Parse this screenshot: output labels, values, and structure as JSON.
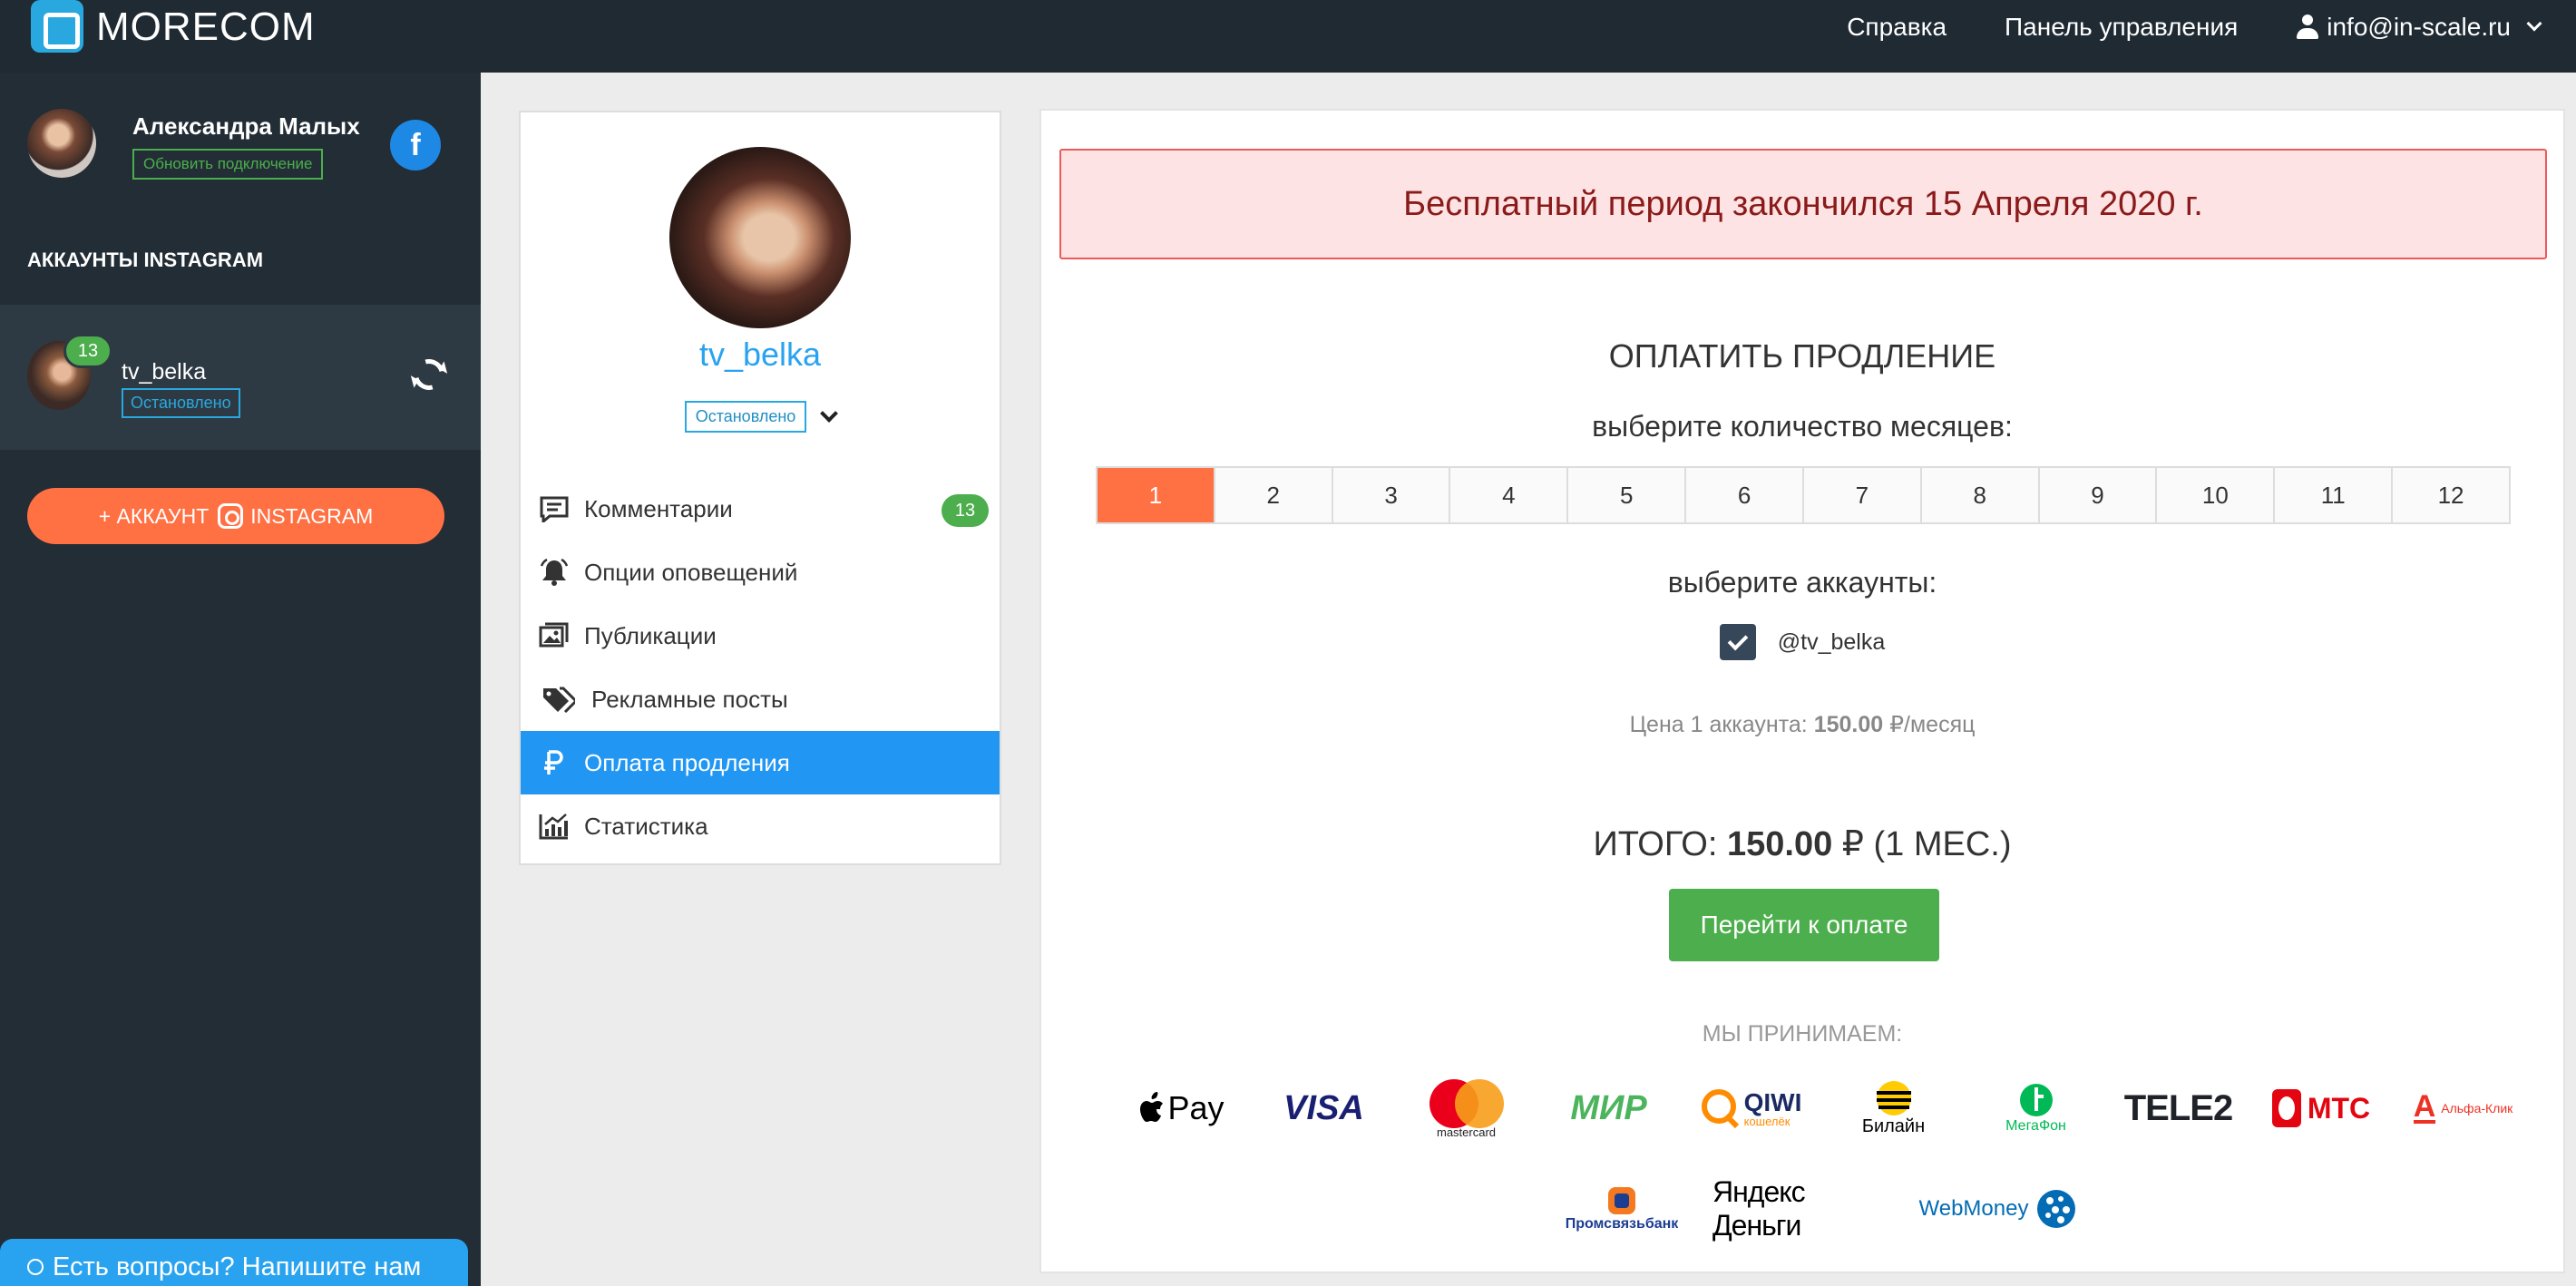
{
  "app": {
    "name": "MORECOM"
  },
  "topnav": {
    "help": "Справка",
    "dashboard": "Панель управления",
    "user_email": "info@in-scale.ru"
  },
  "sidebar": {
    "profile_name": "Александра Малых",
    "update_connection": "Обновить подключение",
    "fb_letter": "f",
    "heading": "АККАУНТЫ INSTAGRAM",
    "account": {
      "username": "tv_belka",
      "status": "Остановлено",
      "badge": "13"
    },
    "add_account_prefix": "+ АККАУНТ",
    "add_account_suffix": "INSTAGRAM",
    "chat": "Есть вопросы? Напишите нам"
  },
  "profile_card": {
    "username": "tv_belka",
    "status": "Остановлено",
    "menu": [
      {
        "label": "Комментарии",
        "badge": "13"
      },
      {
        "label": "Опции оповещений"
      },
      {
        "label": "Публикации"
      },
      {
        "label": "Рекламные посты"
      },
      {
        "label": "Оплата продления"
      },
      {
        "label": "Статистика"
      }
    ]
  },
  "payment": {
    "alert": "Бесплатный период закончился 15 Апреля 2020 г.",
    "title": "ОПЛАТИТЬ ПРОДЛЕНИЕ",
    "months_label": "выберите количество месяцев:",
    "months": [
      "1",
      "2",
      "3",
      "4",
      "5",
      "6",
      "7",
      "8",
      "9",
      "10",
      "11",
      "12"
    ],
    "selected_month": "1",
    "accounts_label": "выберите аккаунты:",
    "account": "@tv_belka",
    "price_prefix": "Цена 1 аккаунта:",
    "price_value": "150.00",
    "price_suffix": "₽/месяц",
    "total_prefix": "ИТОГО:",
    "total_value": "150.00",
    "total_suffix": "₽ (1 МЕС.)",
    "pay_button": "Перейти к оплате",
    "accept_label": "МЫ ПРИНИМАЕМ:",
    "methods_row1": [
      "Pay",
      "VISA",
      "mastercard",
      "МИР",
      "QIWI",
      "кошелёк",
      "Билайн",
      "МегаФон",
      "TELE2",
      "МТС",
      "Альфа-Клик"
    ],
    "methods_row2": [
      "Промсвязьбанк",
      "Яндекс Деньги",
      "WebMoney"
    ]
  },
  "colors": {
    "accent_orange": "#ff7043",
    "accent_blue": "#2196f3",
    "success_green": "#4cae4c",
    "alert_red": "#ed5a5a",
    "sidebar_bg": "#222d35",
    "topbar_bg": "#1f2a33"
  }
}
